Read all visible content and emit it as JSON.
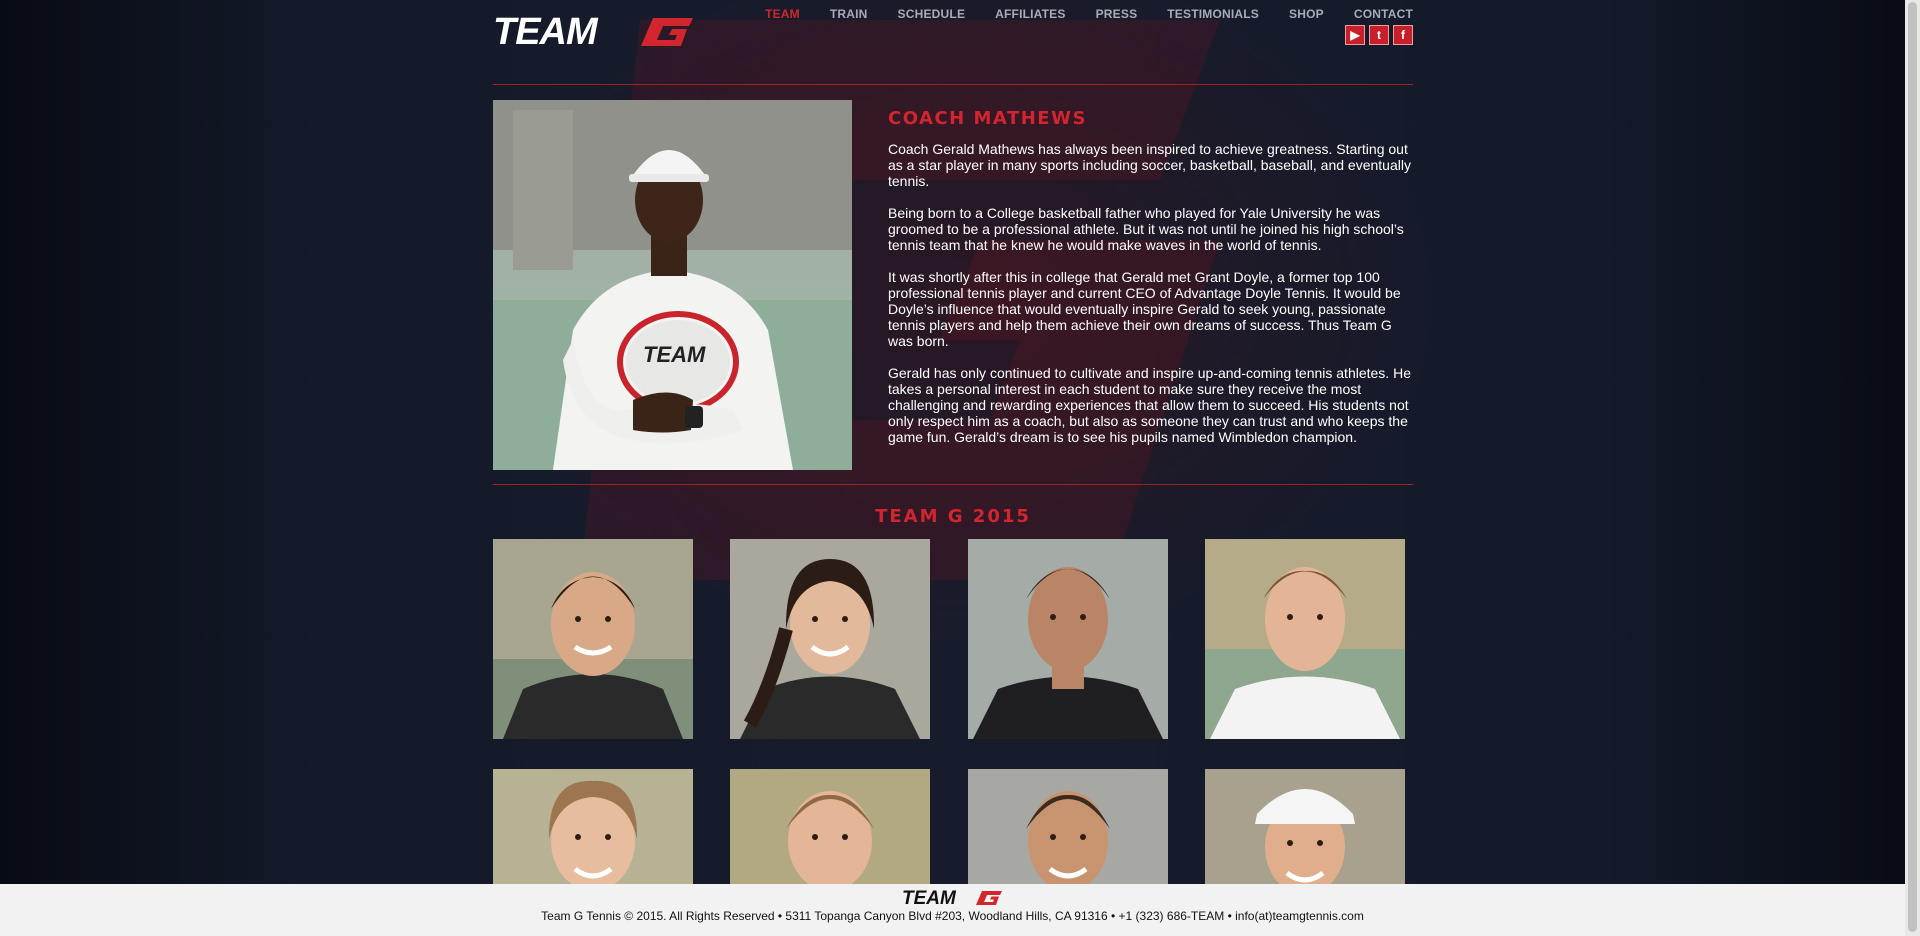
{
  "header": {
    "logo_text": "TEAMG",
    "nav": [
      "TEAM",
      "TRAIN",
      "SCHEDULE",
      "AFFILIATES",
      "PRESS",
      "TESTIMONIALS",
      "SHOP",
      "CONTACT"
    ],
    "active_nav": "TEAM",
    "social": [
      {
        "icon": "youtube-icon",
        "glyph": "▶"
      },
      {
        "icon": "twitter-icon",
        "glyph": "t"
      },
      {
        "icon": "facebook-icon",
        "glyph": "f"
      }
    ]
  },
  "coach": {
    "title": "COACH MATHEWS",
    "paragraphs": [
      "Coach Gerald Mathews has always been inspired to achieve greatness. Starting out as a star player in many sports including soccer, basketball, baseball, and eventually tennis.",
      "Being born to a College basketball father who played for Yale University he was groomed to be a professional athlete. But it was not until he joined his high school’s tennis team that he knew he would make waves in the world of tennis.",
      "It was shortly after this in college that Gerald met Grant Doyle, a former top 100 professional tennis player and current CEO of Advantage Doyle Tennis. It would be Doyle’s influence that would eventually inspire Gerald to seek young, passionate tennis players and help them achieve their own dreams of success. Thus Team G was born.",
      "Gerald has only continued to cultivate and inspire up-and-coming tennis athletes. He takes a personal interest in each student to make sure they receive the most challenging and rewarding experiences that allow them to succeed. His students not only respect him as a coach, but also as someone they can trust and who keeps the game fun. Gerald’s dream is to see his pupils named Wimbledon champion."
    ]
  },
  "team": {
    "title": "TEAM G 2015"
  },
  "footer": {
    "logo_text": "TEAMG",
    "text": "Team G Tennis © 2015. All Rights Reserved • 5311 Topanga Canyon Blvd #203, Woodland Hills, CA 91316 • +1 (323) 686-TEAM • info(at)teamgtennis.com"
  },
  "colors": {
    "accent": "#d3252d",
    "background": "#141a2a",
    "footer_bg": "#f2f2f2"
  }
}
